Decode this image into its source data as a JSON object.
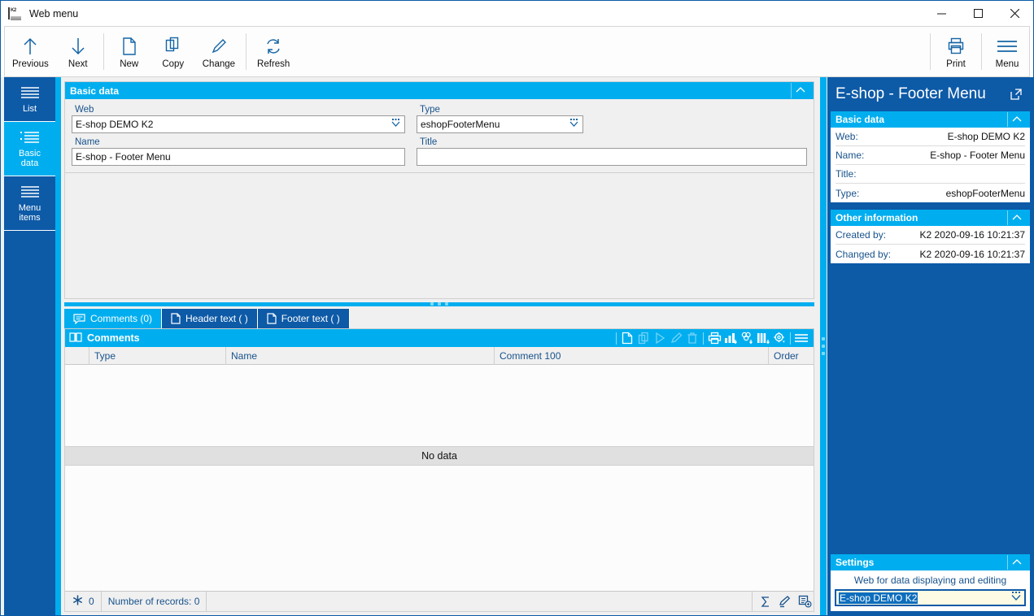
{
  "window": {
    "title": "Web menu",
    "app_icon": "k2-app-icon",
    "controls": {
      "minimize": "minimize-icon",
      "maximize": "maximize-icon",
      "close": "close-icon"
    }
  },
  "ribbon": {
    "buttons": [
      {
        "label": "Previous",
        "icon": "arrow-up-icon"
      },
      {
        "label": "Next",
        "icon": "arrow-down-icon"
      },
      {
        "label": "New",
        "icon": "document-icon"
      },
      {
        "label": "Copy",
        "icon": "copy-icon"
      },
      {
        "label": "Change",
        "icon": "pencil-icon"
      },
      {
        "label": "Refresh",
        "icon": "refresh-icon"
      }
    ],
    "right_buttons": [
      {
        "label": "Print",
        "icon": "printer-icon"
      },
      {
        "label": "Menu",
        "icon": "hamburger-menu-icon"
      }
    ]
  },
  "sidebar": {
    "items": [
      {
        "label": "List",
        "icon": "list-lines-icon",
        "active": false
      },
      {
        "label": "Basic\ndata",
        "label_line1": "Basic",
        "label_line2": "data",
        "icon": "bullet-list-icon",
        "active": true
      },
      {
        "label": "Menu\nitems",
        "label_line1": "Menu",
        "label_line2": "items",
        "icon": "list-lines-icon",
        "active": false
      }
    ]
  },
  "basic_data": {
    "header": "Basic data",
    "collapse_icon": "chevron-up-icon",
    "fields": {
      "web": {
        "label": "Web",
        "value": "E-shop DEMO K2",
        "dropdown_icon": "lookup-caret-icon"
      },
      "type": {
        "label": "Type",
        "value": "eshopFooterMenu",
        "dropdown_icon": "lookup-caret-icon"
      },
      "name": {
        "label": "Name",
        "value": "E-shop - Footer Menu"
      },
      "title": {
        "label": "Title",
        "value": ""
      }
    }
  },
  "tabs": [
    {
      "label": "Comments (0)",
      "icon": "comment-icon",
      "active": true
    },
    {
      "label": "Header text ( )",
      "icon": "document-icon",
      "active": false
    },
    {
      "label": "Footer text ( )",
      "icon": "document-icon",
      "active": false
    }
  ],
  "comments_grid": {
    "header": "Comments",
    "header_icon": "book-icon",
    "toolbar": [
      {
        "name": "new-record-icon",
        "enabled": true
      },
      {
        "name": "copy-record-icon",
        "enabled": false
      },
      {
        "name": "run-icon",
        "enabled": false
      },
      {
        "name": "edit-record-icon",
        "enabled": false
      },
      {
        "name": "delete-record-icon",
        "enabled": false
      },
      {
        "name": "print-icon",
        "enabled": true
      },
      {
        "name": "chart-export-icon",
        "enabled": true
      },
      {
        "name": "cube-export-icon",
        "enabled": true
      },
      {
        "name": "columns-export-icon",
        "enabled": true
      },
      {
        "name": "settings-gear-icon",
        "enabled": true
      },
      {
        "name": "grid-menu-icon",
        "enabled": true
      }
    ],
    "columns": [
      "Type",
      "Name",
      "Comment 100",
      "Order"
    ],
    "rows": [],
    "empty_text": "No data",
    "status": {
      "marked_icon": "asterisk-marked-icon",
      "marked_count": "0",
      "records_label": "Number of records: 0",
      "buttons": [
        {
          "name": "sum-sigma-icon"
        },
        {
          "name": "edit-pencil-icon"
        },
        {
          "name": "add-record-icon"
        }
      ]
    }
  },
  "right_panel": {
    "title": "E-shop - Footer Menu",
    "expand_icon": "open-external-icon",
    "sections": [
      {
        "title": "Basic data",
        "collapse_icon": "chevron-up-icon",
        "rows": [
          {
            "key": "Web:",
            "value": "E-shop DEMO K2"
          },
          {
            "key": "Name:",
            "value": "E-shop - Footer Menu"
          },
          {
            "key": "Title:",
            "value": ""
          },
          {
            "key": "Type:",
            "value": "eshopFooterMenu"
          }
        ]
      },
      {
        "title": "Other information",
        "collapse_icon": "chevron-up-icon",
        "rows": [
          {
            "key": "Created by:",
            "value": "K2 2020-09-16 10:21:37"
          },
          {
            "key": "Changed by:",
            "value": "K2 2020-09-16 10:21:37"
          }
        ]
      }
    ],
    "settings": {
      "title": "Settings",
      "collapse_icon": "chevron-up-icon",
      "field_label": "Web for data displaying and editing",
      "field_value": "E-shop DEMO K2",
      "dropdown_icon": "lookup-caret-icon"
    }
  },
  "colors": {
    "accent_cyan": "#00aeef",
    "accent_blue": "#0d5aa7",
    "panel_bg": "#f0f0f0",
    "label_blue": "#17528c",
    "highlight_yellow": "#fdfbe4"
  }
}
